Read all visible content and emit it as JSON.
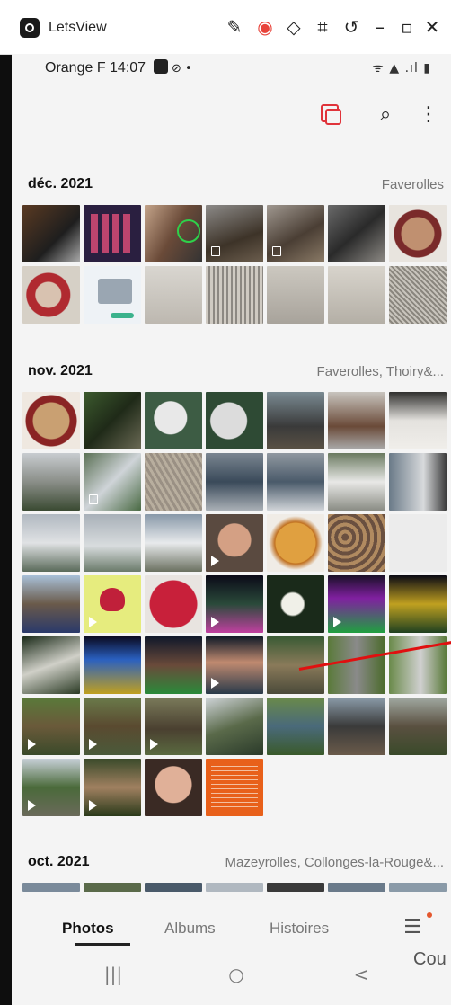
{
  "window": {
    "title": "LetsView",
    "controls": [
      "brush-icon",
      "record-icon",
      "pin-icon",
      "crop-icon",
      "rotate-icon",
      "minimize-icon",
      "maximize-icon",
      "close-icon"
    ]
  },
  "statusbar": {
    "left": "Orange F 14:07",
    "right": "ᯤ ▲ .ıl ▮"
  },
  "header": {
    "actions": [
      "select-icon",
      "search-icon",
      "more-icon"
    ]
  },
  "sections": [
    {
      "date": "déc. 2021",
      "place": "Faverolles"
    },
    {
      "date": "nov. 2021",
      "place": "Faverolles, Thoiry&..."
    },
    {
      "date": "oct. 2021",
      "place": "Mazeyrolles, Collonges-la-Rouge&..."
    }
  ],
  "nav": {
    "photos": "Photos",
    "albums": "Albums",
    "stories": "Histoires",
    "menu": "☰"
  },
  "overlay_text": "Cou",
  "system": {
    "recents": "|||",
    "home": "○",
    "back": "<"
  },
  "colors": {
    "accent_red": "#e0333a",
    "badge_dot": "#e4572e",
    "background": "#f4f4f4"
  }
}
